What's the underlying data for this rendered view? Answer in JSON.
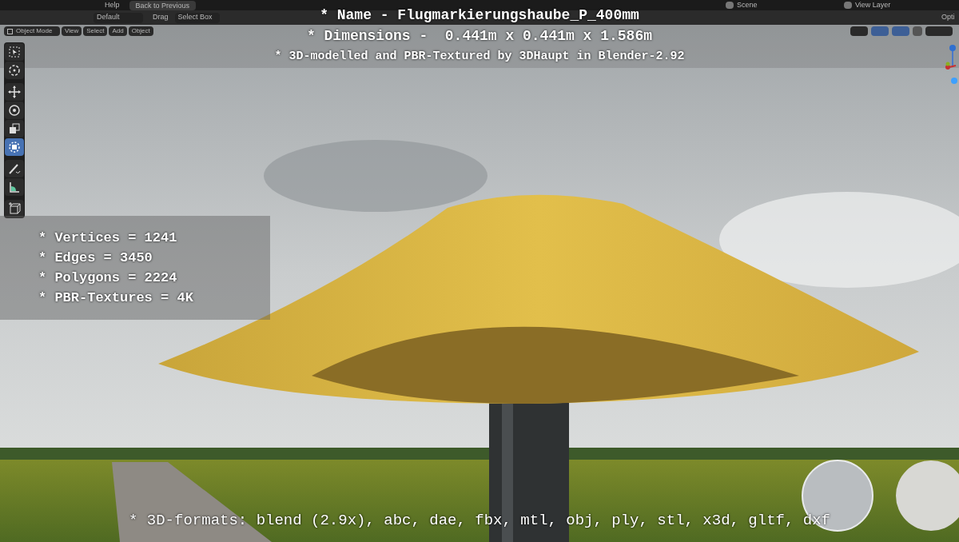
{
  "topbar": {
    "menu": [
      "Help"
    ],
    "back_button": "Back to Previous",
    "scene": "Scene",
    "view_layer": "View Layer"
  },
  "toolbar": {
    "orientation_preset": "Default",
    "drag_label": "Drag",
    "drag_mode": "Select Box",
    "options": "Opti"
  },
  "header": {
    "mode": "Object Mode",
    "menus": [
      "View",
      "Select",
      "Add",
      "Object"
    ]
  },
  "tools": [
    {
      "kind": "select",
      "selected": false
    },
    {
      "kind": "cursor",
      "selected": false
    },
    {
      "kind": "move",
      "selected": false
    },
    {
      "kind": "rotate",
      "selected": false
    },
    {
      "kind": "scale",
      "selected": false
    },
    {
      "kind": "transform",
      "selected": true
    },
    {
      "kind": "annotate",
      "selected": false
    },
    {
      "kind": "measure",
      "selected": false
    },
    {
      "kind": "add-cube",
      "selected": false
    }
  ],
  "title_lines": [
    "* Name - Flugmarkierungshaube_P_400mm",
    "* Dimensions -  0.441m x 0.441m x 1.586m",
    "* 3D-modelled and PBR-Textured by 3DHaupt in Blender-2.92"
  ],
  "stats": [
    "* Vertices = 1241",
    "* Edges = 3450",
    "* Polygons = 2224",
    "* PBR-Textures = 4K"
  ],
  "formats": "* 3D-formats: blend (2.9x), abc, dae, fbx, mtl, obj, ply, stl, x3d, gltf, dxf"
}
